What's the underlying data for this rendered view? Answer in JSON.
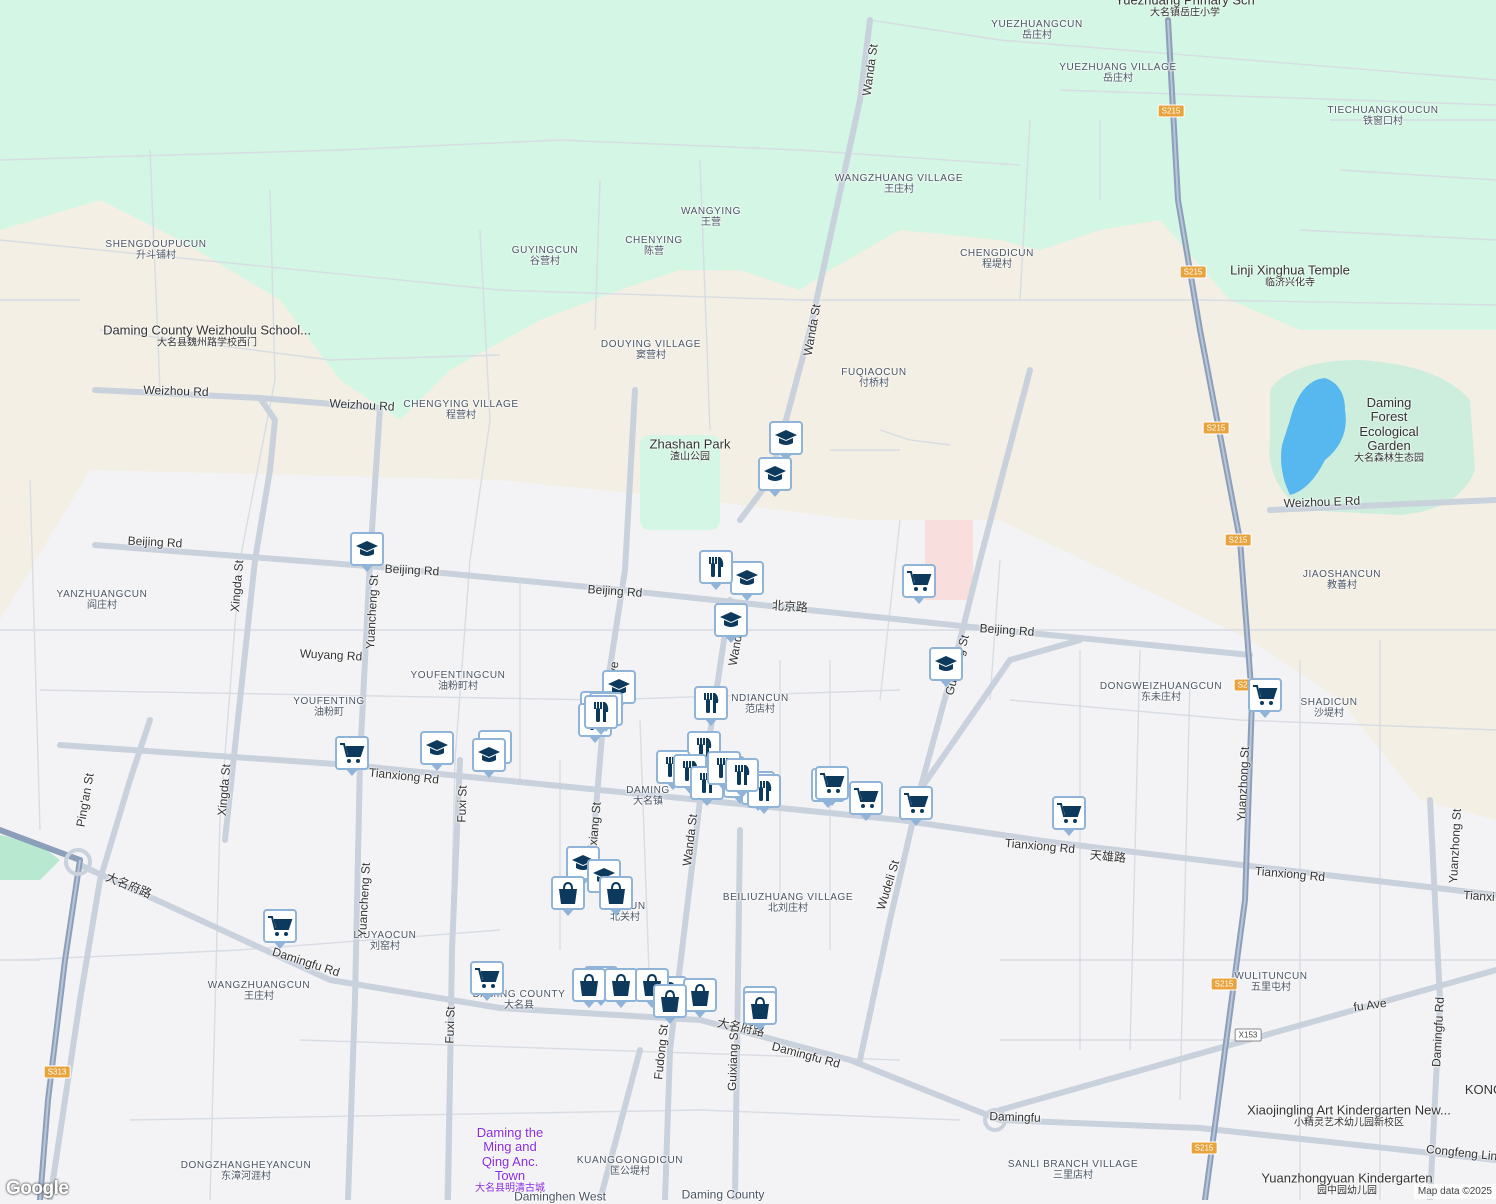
{
  "colors": {
    "green": "#d4f6e4",
    "tan": "#f3efe4",
    "urban": "#f3f3f5",
    "road": "#c9d1dc",
    "highway": "#8c9fba",
    "water": "#56b8ee",
    "pin_icon": "#0d3a5c",
    "pin_border": "#8fb4d8"
  },
  "places": [
    {
      "en": "YUEZHUANGCUN",
      "cn": "岳庄村"
    },
    {
      "en": "YUEZHUANG VILLAGE",
      "cn": "岳庄村"
    },
    {
      "en": "TIECHUANGKOUCUN",
      "cn": "铁窗口村"
    },
    {
      "en": "WANGZHUANG VILLAGE",
      "cn": "王庄村"
    },
    {
      "en": "WANGYING",
      "cn": "王营"
    },
    {
      "en": "CHENYING",
      "cn": "陈营"
    },
    {
      "en": "GUYINGCUN",
      "cn": "谷营村"
    },
    {
      "en": "SHENGDOUPUCUN",
      "cn": "升斗铺村"
    },
    {
      "en": "CHENGDICUN",
      "cn": "程堤村"
    },
    {
      "en": "DOUYING VILLAGE",
      "cn": "窦营村"
    },
    {
      "en": "FUQIAOCUN",
      "cn": "付桥村"
    },
    {
      "en": "CHENGYING VILLAGE",
      "cn": "程营村"
    },
    {
      "en": "YANZHUANGCUN",
      "cn": "阎庄村"
    },
    {
      "en": "JIAOSHANCUN",
      "cn": "教善村"
    },
    {
      "en": "DONGWEIZHUANGCUN",
      "cn": "东未庄村"
    },
    {
      "en": "SHADICUN",
      "cn": "沙堤村"
    },
    {
      "en": "YOUFENTINGCUN",
      "cn": "油粉町村"
    },
    {
      "en": "YOUFENTING",
      "cn": "油粉町"
    },
    {
      "en": "NDIANCUN",
      "cn": "范店村"
    },
    {
      "en": "DAMING",
      "cn": "大名镇"
    },
    {
      "en": "BEILIUZHUANG VILLAGE",
      "cn": "北刘庄村"
    },
    {
      "en": "BE   CUN",
      "cn": "北关村"
    },
    {
      "en": "LIUYAOCUN",
      "cn": "刘窑村"
    },
    {
      "en": "WANGZHUANGCUN",
      "cn": "王庄村"
    },
    {
      "en": "DAMING COUNTY",
      "cn": "大名县"
    },
    {
      "en": "WULITUNCUN",
      "cn": "五里屯村"
    },
    {
      "en": "KUANGGONGDICUN",
      "cn": "匡公堤村"
    },
    {
      "en": "DONGZHANGHEYANCUN",
      "cn": "东漳河涯村"
    },
    {
      "en": "SANLI BRANCH VILLAGE",
      "cn": "三里店村"
    },
    {
      "en": "Daming County",
      "cn": ""
    },
    {
      "en": "Daminghen West",
      "cn": ""
    }
  ],
  "pois": [
    {
      "name": "Yuezhuang Primary Sch",
      "cn": "大名镇岳庄小学"
    },
    {
      "name": "Linji Xinghua Temple",
      "cn": "临济兴化寺"
    },
    {
      "name": "Daming County Weizhoulu School...",
      "cn": "大名县魏州路学校西门"
    },
    {
      "name": "Zhashan Park",
      "cn": "渣山公园"
    },
    {
      "name": "Daming Forest Ecological Garden",
      "cn": "大名森林生态园"
    },
    {
      "name": "Daming the Ming and Qing Anc. Town",
      "cn": "大名县明清古城"
    },
    {
      "name": "Xiaojingling Art Kindergarten New...",
      "cn": "小精灵艺术幼儿园新校区"
    },
    {
      "name": "Yuanzhongyuan Kindergarten",
      "cn": "园中园幼儿园"
    },
    {
      "name": "KONG",
      "cn": ""
    }
  ],
  "roads": [
    "Wanda St",
    "Beijing Rd",
    "Beijing Rd",
    "Beijing Rd",
    "北京路",
    "Beijing Rd",
    "Weizhou Rd",
    "Weizhou Rd",
    "Weizhou E Rd",
    "Wuyang Rd",
    "Jingfu Ave",
    "Wanda St",
    "Guixiang St",
    "Tianxiong Rd",
    "Tianxiong Rd",
    "天雄路",
    "Tianxiong Rd",
    "Tianxi",
    "Ping'an St",
    "Xingda St",
    "Xingda St",
    "Yuancheng St",
    "Yuancheng St",
    "Fuxi St",
    "Fuxi St",
    "Wanda St",
    "Wanda St",
    "Fudong St",
    "Guixiang St",
    "Wudeli St",
    "Yuanzhong St",
    "Yuanzhong St",
    "Damingfu Rd",
    "大名府路",
    "Damingfu Rd",
    "大名府路",
    "Damingfu Rd",
    "Damingfu",
    "Congfeng Line",
    "fu Ave",
    "Guixiang St"
  ],
  "shields": [
    "S215",
    "S215",
    "S215",
    "S215",
    "S215",
    "S215",
    "S215",
    "S313",
    "X153"
  ],
  "pins": {
    "school": 13,
    "restaurant": 16,
    "shopping": 10,
    "grocery": 10
  },
  "footer": {
    "logo": "Google",
    "attribution": "Map data ©2025"
  }
}
